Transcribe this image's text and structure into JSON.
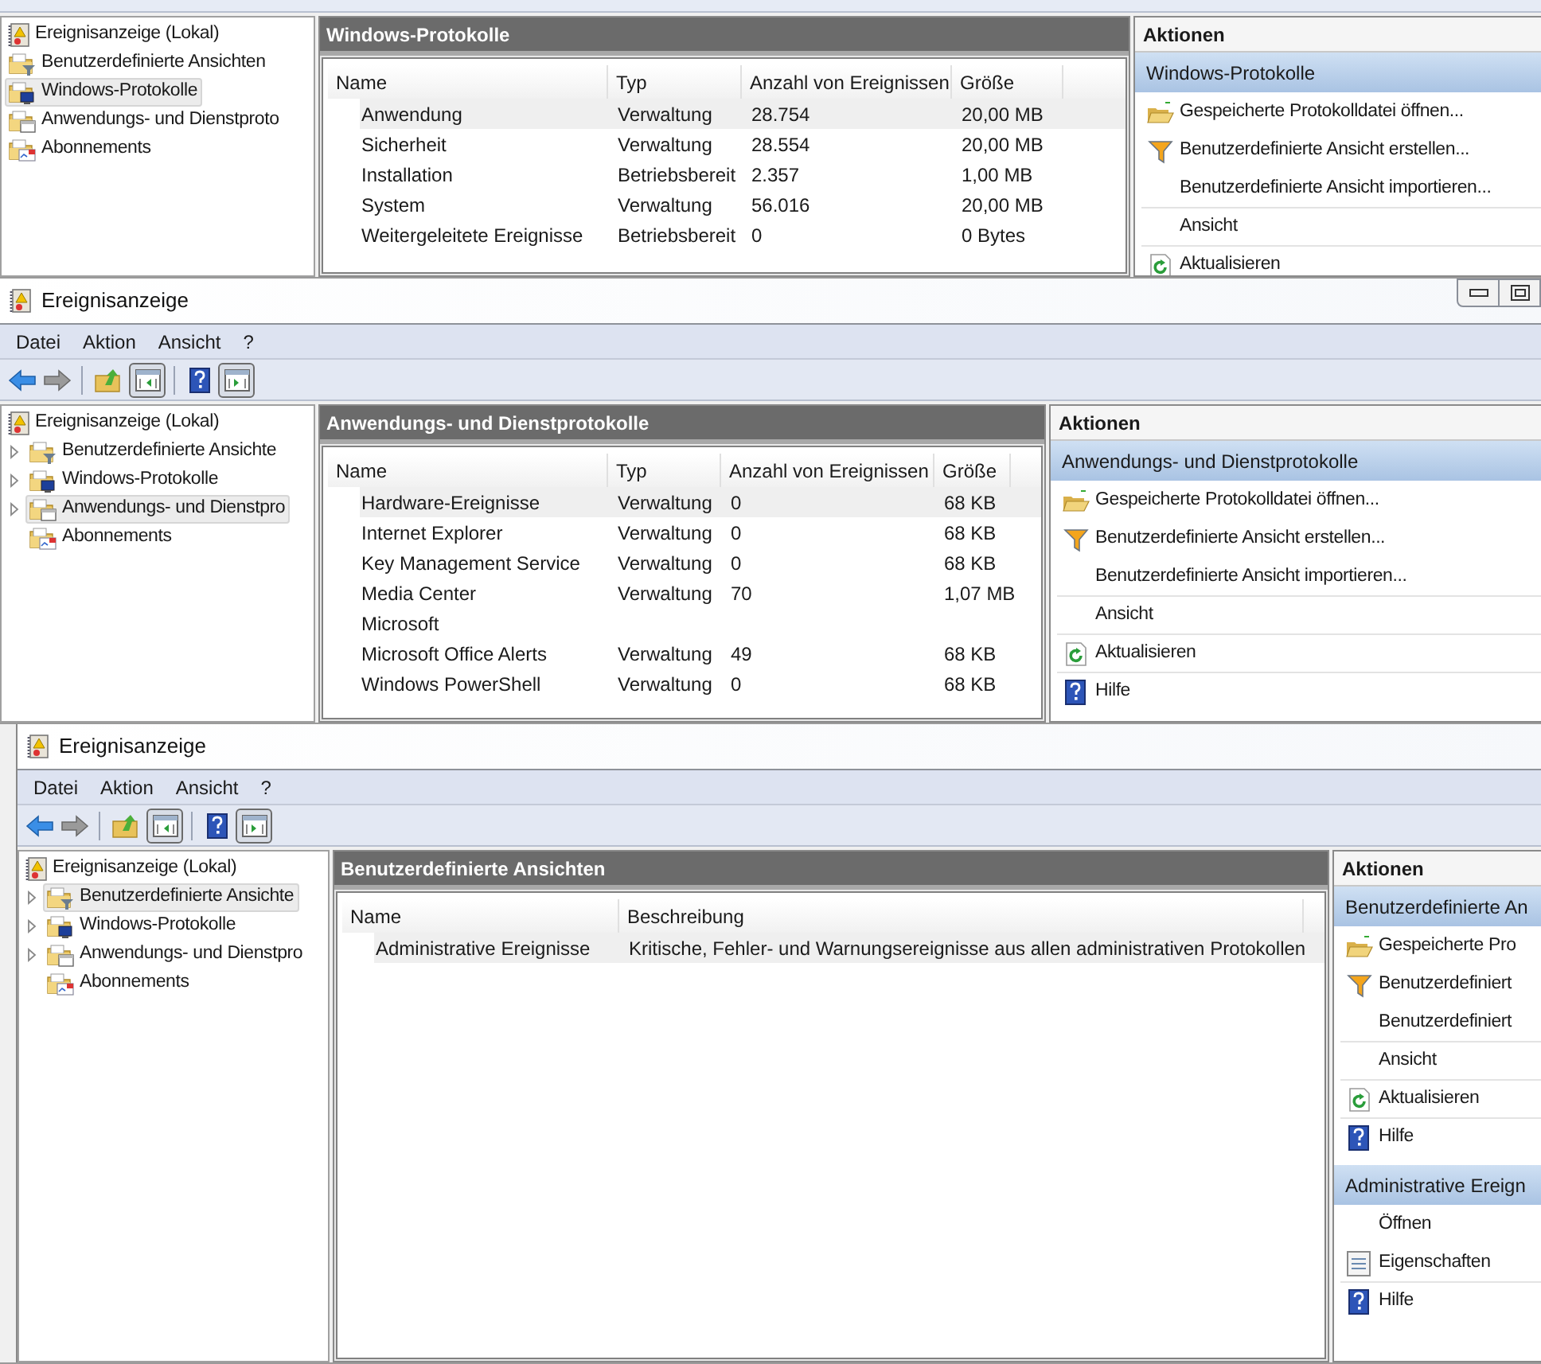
{
  "windows": [
    {
      "tree": {
        "items": [
          {
            "label": "Ereignisanzeige (Lokal)",
            "kind": "viewer",
            "selected": false,
            "children": [
              {
                "label": "Benutzerdefinierte Ansichten",
                "kind": "filter-folder",
                "selected": false,
                "collapsed": false
              },
              {
                "label": "Windows-Protokolle",
                "kind": "windows-folder",
                "selected": true,
                "collapsed": false
              },
              {
                "label": "Anwendungs- und Dienstproto",
                "kind": "app-folder",
                "selected": false,
                "collapsed": false
              },
              {
                "label": "Abonnements",
                "kind": "sub-folder",
                "selected": false,
                "collapsed": false
              }
            ]
          }
        ]
      },
      "center": {
        "title": "Windows-Protokolle",
        "columns": [
          "Name",
          "Typ",
          "Anzahl von Ereignissen",
          "Größe"
        ],
        "rows": [
          {
            "cells": [
              "Anwendung",
              "Verwaltung",
              "28.754",
              "20,00 MB"
            ],
            "selected": true
          },
          {
            "cells": [
              "Sicherheit",
              "Verwaltung",
              "28.554",
              "20,00 MB"
            ],
            "selected": false
          },
          {
            "cells": [
              "Installation",
              "Betriebsbereit",
              "2.357",
              "1,00 MB"
            ],
            "selected": false
          },
          {
            "cells": [
              "System",
              "Verwaltung",
              "56.016",
              "20,00 MB"
            ],
            "selected": false
          },
          {
            "cells": [
              "Weitergeleitete Ereignisse",
              "Betriebsbereit",
              "0",
              "0 Bytes"
            ],
            "selected": false
          }
        ]
      },
      "actions": {
        "title": "Aktionen",
        "groups": [
          {
            "title": "Windows-Protokolle",
            "items": [
              {
                "label": "Gespeicherte Protokolldatei öffnen...",
                "kind": "open",
                "divider": false
              },
              {
                "label": "Benutzerdefinierte Ansicht erstellen...",
                "kind": "filter",
                "divider": false
              },
              {
                "label": "Benutzerdefinierte Ansicht importieren...",
                "kind": "plain",
                "divider": false
              },
              {
                "label": "Ansicht",
                "kind": "plain",
                "divider": true
              },
              {
                "label": "Aktualisieren",
                "kind": "refresh",
                "divider": true
              }
            ]
          }
        ]
      }
    },
    {
      "title": "Ereignisanzeige",
      "window_buttons": [
        {
          "kind": "minimize"
        },
        {
          "kind": "maximize"
        }
      ],
      "menu": [
        "Datei",
        "Aktion",
        "Ansicht",
        "?"
      ],
      "toolbar": [
        {
          "kind": "back"
        },
        {
          "kind": "forward"
        },
        {
          "kind": "sep"
        },
        {
          "kind": "up"
        },
        {
          "kind": "tree-pane"
        },
        {
          "kind": "sep"
        },
        {
          "kind": "help"
        },
        {
          "kind": "action-pane"
        }
      ],
      "tree": {
        "items": [
          {
            "label": "Ereignisanzeige (Lokal)",
            "kind": "viewer",
            "selected": false,
            "children": [
              {
                "label": "Benutzerdefinierte Ansichte",
                "kind": "filter-folder",
                "selected": false,
                "collapsed": true
              },
              {
                "label": "Windows-Protokolle",
                "kind": "windows-folder",
                "selected": false,
                "collapsed": true
              },
              {
                "label": "Anwendungs- und Dienstpro",
                "kind": "app-folder",
                "selected": true,
                "collapsed": true
              },
              {
                "label": "Abonnements",
                "kind": "sub-folder",
                "selected": false,
                "collapsed": false
              }
            ]
          }
        ]
      },
      "center": {
        "title": "Anwendungs- und Dienstprotokolle",
        "columns": [
          "Name",
          "Typ",
          "Anzahl von Ereignissen",
          "Größe"
        ],
        "rows": [
          {
            "cells": [
              "Hardware-Ereignisse",
              "Verwaltung",
              "0",
              "68 KB"
            ],
            "selected": true
          },
          {
            "cells": [
              "Internet Explorer",
              "Verwaltung",
              "0",
              "68 KB"
            ],
            "selected": false
          },
          {
            "cells": [
              "Key Management Service",
              "Verwaltung",
              "0",
              "68 KB"
            ],
            "selected": false
          },
          {
            "cells": [
              "Media Center",
              "Verwaltung",
              "70",
              "1,07 MB"
            ],
            "selected": false
          },
          {
            "cells": [
              "Microsoft"
            ],
            "selected": false
          },
          {
            "cells": [
              "Microsoft Office Alerts",
              "Verwaltung",
              "49",
              "68 KB"
            ],
            "selected": false
          },
          {
            "cells": [
              "Windows PowerShell",
              "Verwaltung",
              "0",
              "68 KB"
            ],
            "selected": false
          }
        ]
      },
      "actions": {
        "title": "Aktionen",
        "groups": [
          {
            "title": "Anwendungs- und Dienstprotokolle",
            "items": [
              {
                "label": "Gespeicherte Protokolldatei öffnen...",
                "kind": "open",
                "divider": false
              },
              {
                "label": "Benutzerdefinierte Ansicht erstellen...",
                "kind": "filter",
                "divider": false
              },
              {
                "label": "Benutzerdefinierte Ansicht importieren...",
                "kind": "plain",
                "divider": false
              },
              {
                "label": "Ansicht",
                "kind": "plain",
                "divider": true
              },
              {
                "label": "Aktualisieren",
                "kind": "refresh",
                "divider": true
              },
              {
                "label": "Hilfe",
                "kind": "help",
                "divider": true
              }
            ]
          }
        ]
      }
    },
    {
      "title": "Ereignisanzeige",
      "menu": [
        "Datei",
        "Aktion",
        "Ansicht",
        "?"
      ],
      "toolbar": [
        {
          "kind": "back"
        },
        {
          "kind": "forward"
        },
        {
          "kind": "sep"
        },
        {
          "kind": "up"
        },
        {
          "kind": "tree-pane"
        },
        {
          "kind": "sep"
        },
        {
          "kind": "help"
        },
        {
          "kind": "action-pane"
        }
      ],
      "tree": {
        "items": [
          {
            "label": "Ereignisanzeige (Lokal)",
            "kind": "viewer",
            "selected": false,
            "children": [
              {
                "label": "Benutzerdefinierte Ansichte",
                "kind": "filter-folder",
                "selected": true,
                "collapsed": true
              },
              {
                "label": "Windows-Protokolle",
                "kind": "windows-folder",
                "selected": false,
                "collapsed": true
              },
              {
                "label": "Anwendungs- und Dienstpro",
                "kind": "app-folder",
                "selected": false,
                "collapsed": true
              },
              {
                "label": "Abonnements",
                "kind": "sub-folder",
                "selected": false,
                "collapsed": false
              }
            ]
          }
        ]
      },
      "center": {
        "title": "Benutzerdefinierte Ansichten",
        "columns": [
          "Name",
          "Beschreibung"
        ],
        "rows": [
          {
            "cells": [
              "Administrative Ereignisse",
              "Kritische, Fehler- und Warnungsereignisse aus allen administrativen Protokollen"
            ],
            "selected": true
          }
        ]
      },
      "actions": {
        "title": "Aktionen",
        "groups": [
          {
            "title": "Benutzerdefinierte An",
            "items": [
              {
                "label": "Gespeicherte Pro",
                "kind": "open",
                "divider": false
              },
              {
                "label": "Benutzerdefiniert",
                "kind": "filter",
                "divider": false
              },
              {
                "label": "Benutzerdefiniert",
                "kind": "plain",
                "divider": false
              },
              {
                "label": "Ansicht",
                "kind": "plain",
                "divider": true
              },
              {
                "label": "Aktualisieren",
                "kind": "refresh",
                "divider": true
              },
              {
                "label": "Hilfe",
                "kind": "help",
                "divider": true
              }
            ]
          },
          {
            "title": "Administrative Ereign",
            "items": [
              {
                "label": "Öffnen",
                "kind": "plain",
                "divider": false
              },
              {
                "label": "Eigenschaften",
                "kind": "properties",
                "divider": false
              },
              {
                "label": "Hilfe",
                "kind": "help",
                "divider": true
              }
            ]
          }
        ]
      }
    }
  ]
}
